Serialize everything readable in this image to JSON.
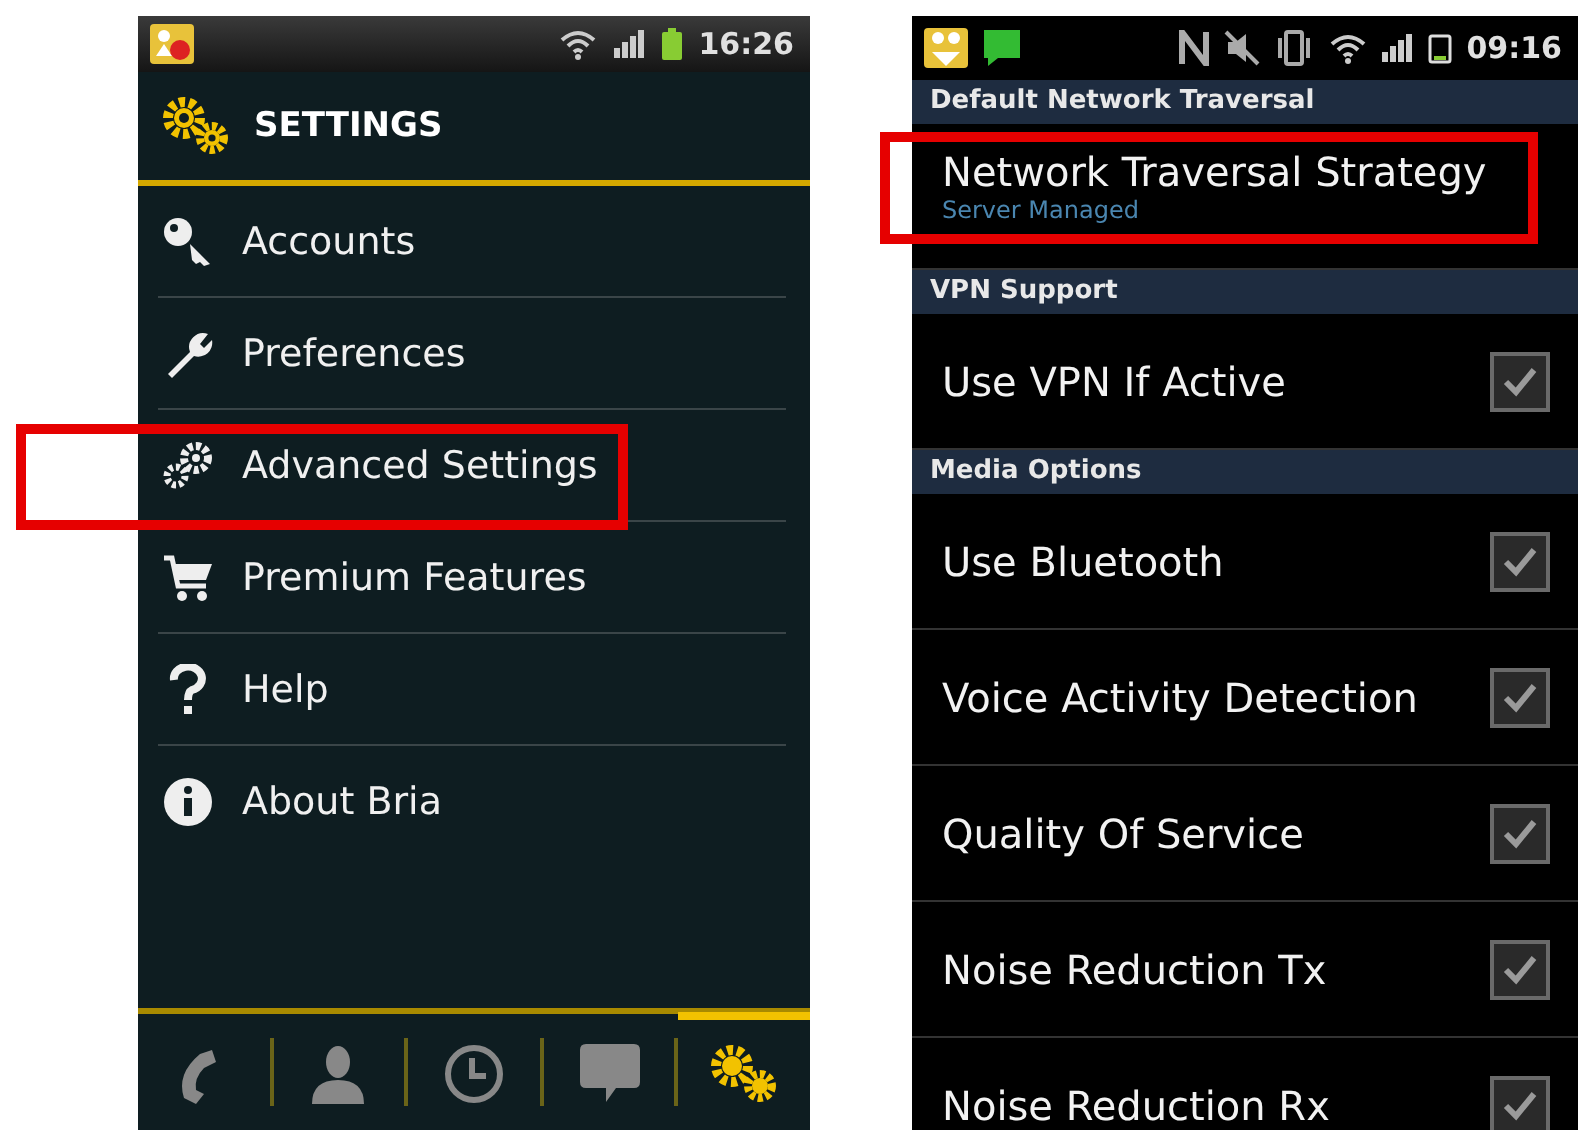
{
  "left_phone": {
    "status_bar": {
      "time": "16:26"
    },
    "header": {
      "title": "SETTINGS"
    },
    "menu": [
      {
        "label": "Accounts",
        "kind": "key"
      },
      {
        "label": "Preferences",
        "kind": "wrench"
      },
      {
        "label": "Advanced Settings",
        "kind": "gears"
      },
      {
        "label": "Premium Features",
        "kind": "cart"
      },
      {
        "label": "Help",
        "kind": "help"
      },
      {
        "label": "About Bria",
        "kind": "info"
      }
    ],
    "tab_bar": [
      {
        "kind": "phone",
        "selected": false
      },
      {
        "kind": "contact",
        "selected": false
      },
      {
        "kind": "clock",
        "selected": false
      },
      {
        "kind": "chat",
        "selected": false
      },
      {
        "kind": "settings",
        "selected": true
      }
    ]
  },
  "right_phone": {
    "status_bar": {
      "time": "09:16"
    },
    "sections": [
      {
        "title": "Default Network Traversal",
        "items": [
          {
            "kind": "list",
            "title": "Network Traversal Strategy",
            "summary": "Server Managed"
          }
        ]
      },
      {
        "title": "VPN Support",
        "items": [
          {
            "kind": "checkbox",
            "title": "Use VPN If Active",
            "checked": true
          }
        ]
      },
      {
        "title": "Media Options",
        "items": [
          {
            "kind": "checkbox",
            "title": "Use Bluetooth",
            "checked": true
          },
          {
            "kind": "checkbox",
            "title": "Voice Activity Detection",
            "checked": true
          },
          {
            "kind": "checkbox",
            "title": "Quality Of Service",
            "checked": true
          },
          {
            "kind": "checkbox",
            "title": "Noise Reduction Tx",
            "checked": true
          },
          {
            "kind": "checkbox",
            "title": "Noise Reduction Rx",
            "checked": true
          }
        ]
      }
    ]
  }
}
